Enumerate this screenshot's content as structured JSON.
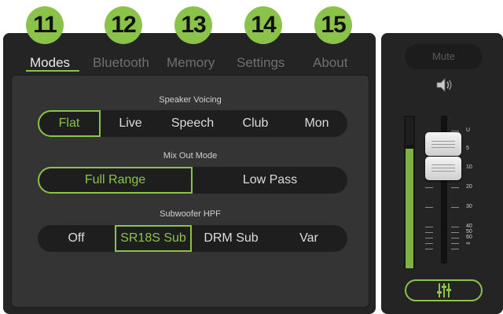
{
  "callouts": [
    "11",
    "12",
    "13",
    "14",
    "15"
  ],
  "tabs": [
    {
      "label": "Modes",
      "active": true
    },
    {
      "label": "Bluetooth",
      "active": false
    },
    {
      "label": "Memory",
      "active": false
    },
    {
      "label": "Settings",
      "active": false
    },
    {
      "label": "About",
      "active": false
    }
  ],
  "speaker_voicing": {
    "title": "Speaker Voicing",
    "options": [
      "Flat",
      "Live",
      "Speech",
      "Club",
      "Mon"
    ],
    "selected": "Flat"
  },
  "mix_out_mode": {
    "title": "Mix Out Mode",
    "options": [
      "Full Range",
      "Low Pass"
    ],
    "selected": "Full Range"
  },
  "subwoofer_hpf": {
    "title": "Subwoofer HPF",
    "options": [
      "Off",
      "SR18S Sub",
      "DRM Sub",
      "Var"
    ],
    "selected": "SR18S Sub"
  },
  "channel": {
    "mute_label": "Mute",
    "meter_level": 0.79,
    "fader_scale": [
      "U",
      "5",
      "10",
      "20",
      "30",
      "40",
      "50",
      "60",
      "∞"
    ]
  },
  "colors": {
    "accent": "#8bc34a",
    "background": "#242424",
    "panel": "#343434"
  },
  "icons": [
    "speaker-icon",
    "eq-sliders-icon"
  ]
}
